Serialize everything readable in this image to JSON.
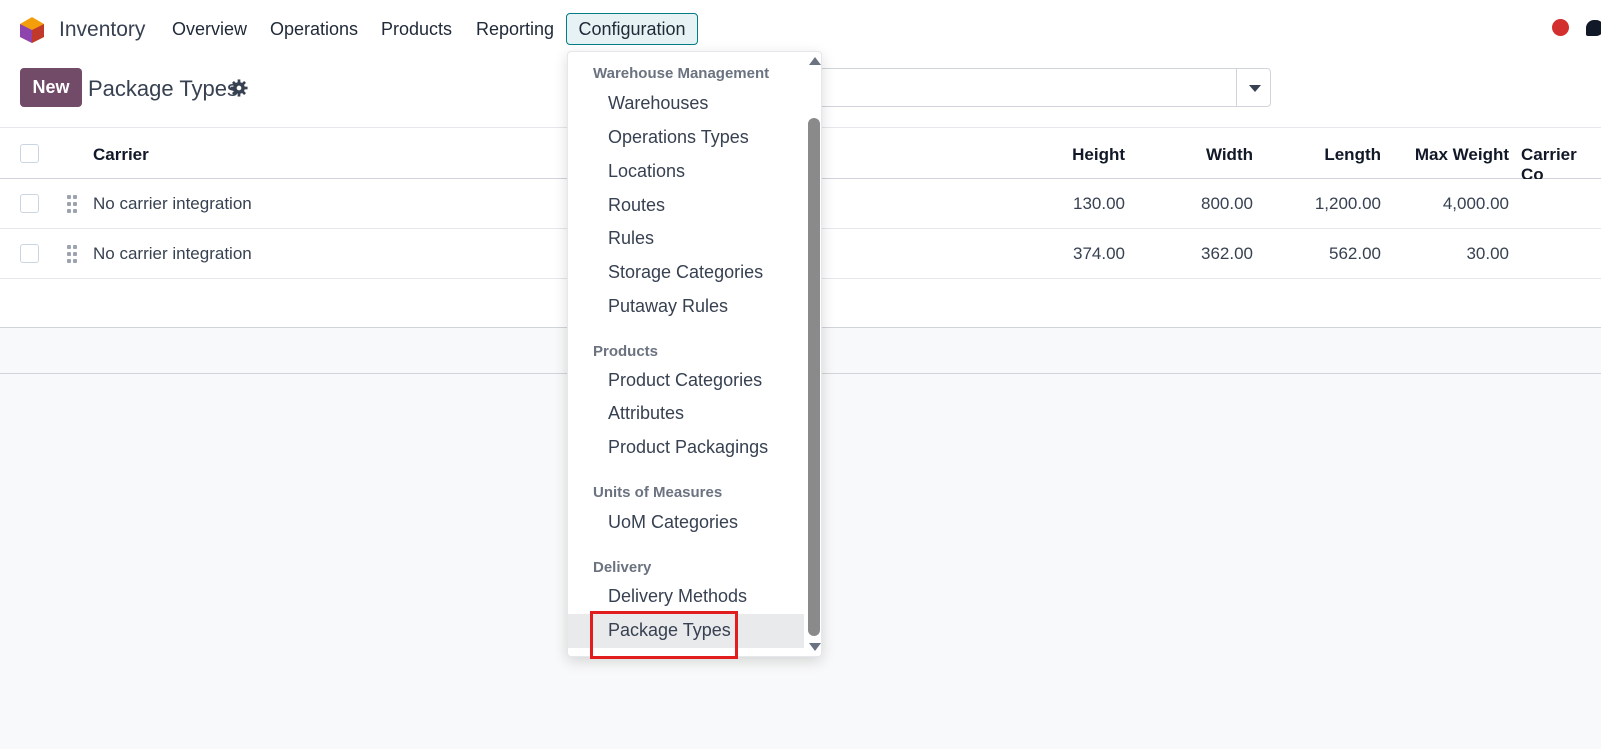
{
  "navbar": {
    "app_name": "Inventory",
    "menu": [
      "Overview",
      "Operations",
      "Products",
      "Reporting",
      "Configuration"
    ],
    "brand_color": "#714b67"
  },
  "control": {
    "new_label": "New",
    "title": "Package Types"
  },
  "table": {
    "columns": [
      "Carrier",
      "Height",
      "Width",
      "Length",
      "Max Weight",
      "Carrier Co"
    ],
    "rows": [
      {
        "carrier": "No carrier integration",
        "height": "130.00",
        "width": "800.00",
        "length": "1,200.00",
        "max_weight": "4,000.00"
      },
      {
        "carrier": "No carrier integration",
        "height": "374.00",
        "width": "362.00",
        "length": "562.00",
        "max_weight": "30.00"
      }
    ]
  },
  "dropdown": {
    "sections": [
      {
        "header": "Warehouse Management",
        "items": [
          "Warehouses",
          "Operations Types",
          "Locations",
          "Routes",
          "Rules",
          "Storage Categories",
          "Putaway Rules"
        ]
      },
      {
        "header": "Products",
        "items": [
          "Product Categories",
          "Attributes",
          "Product Packagings"
        ]
      },
      {
        "header": "Units of Measures",
        "items": [
          "UoM Categories"
        ]
      },
      {
        "header": "Delivery",
        "items": [
          "Delivery Methods",
          "Package Types"
        ]
      }
    ],
    "active_item": "Package Types",
    "highlight_color": "#e11d1d"
  }
}
